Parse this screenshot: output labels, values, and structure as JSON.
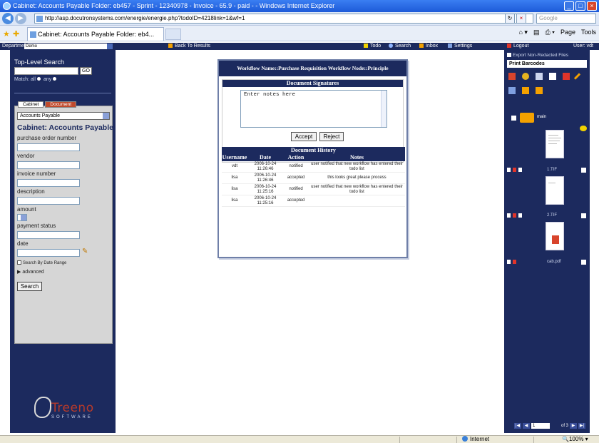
{
  "browser": {
    "title": "Cabinet: Accounts Payable Folder: eb457 - Sprint - 12340978 - Invoice - 65.9 - paid - - Windows Internet Explorer",
    "url": "http://asp.docutronsystems.com/energie/energie.php?todoID=4218link=1&wf=1",
    "search_placeholder": "Google",
    "tab_title": "Cabinet: Accounts Payable Folder: eb4...",
    "cmd_page": "Page",
    "cmd_tools": "Tools",
    "status_zone": "Internet",
    "zoom": "100%"
  },
  "appbar": {
    "department_label": "Department:",
    "department_value": "Demo",
    "back_link": "Back To Results",
    "todo": "Todo",
    "search": "Search",
    "inbox": "Inbox",
    "settings": "Settings",
    "logout": "Logout",
    "user": "User: vdt"
  },
  "left": {
    "top_level_search": "Top-Level Search",
    "go": "GO",
    "match_label": "Match:",
    "match_all": "all",
    "match_any": "any",
    "tab_cabinet": "Cabinet",
    "tab_document": "Document",
    "cabinet_select": "Accounts Payable",
    "cabinet_heading": "Cabinet: Accounts Payable",
    "fields": {
      "po": "purchase order number",
      "vendor": "vendor",
      "invoice": "invoice number",
      "description": "description",
      "amount": "amount",
      "payment_status": "payment status",
      "date": "date"
    },
    "date_range": "Search By Date Range",
    "advanced": "advanced",
    "search_button": "Search",
    "logo_name": "Treeno",
    "logo_sub": "SOFTWARE"
  },
  "dialog": {
    "header": "Workflow Name::Purchase Requisition Workflow Node::Principle",
    "signatures_title": "Document Signatures",
    "notes_text": "Enter notes here",
    "accept": "Accept",
    "reject": "Reject",
    "history_title": "Document History",
    "columns": [
      "Username",
      "Date",
      "Action",
      "Notes"
    ],
    "rows": [
      {
        "user": "vdt",
        "date": "2006-10-24 11:26:46",
        "action": "notified",
        "notes": "user notified that new workflow has entered their todo list"
      },
      {
        "user": "lisa",
        "date": "2006-10-24 11:26:46",
        "action": "accepted",
        "notes": "this looks great please process"
      },
      {
        "user": "lisa",
        "date": "2006-10-24 11:25:16",
        "action": "notified",
        "notes": "user notified that new workflow has entered their todo list"
      },
      {
        "user": "lisa",
        "date": "2006-10-24 11:25:16",
        "action": "accepted",
        "notes": ""
      }
    ]
  },
  "right": {
    "export": "Export Non-Redacted Files",
    "print_barcodes": "Print Barcodes",
    "folder": "main",
    "files": [
      "1.TIF",
      "2.TIF",
      "cab.pdf"
    ],
    "page_value": "1",
    "page_of": "of 3"
  }
}
